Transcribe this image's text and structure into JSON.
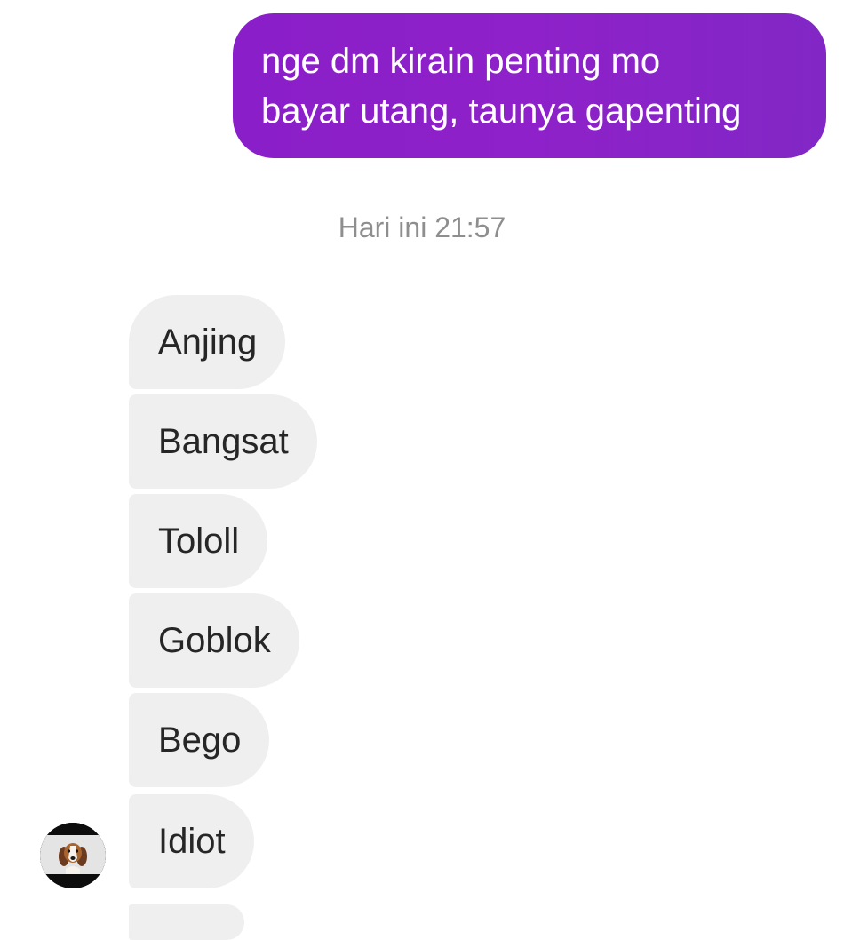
{
  "sent_message": {
    "lines": [
      "nge dm kirain penting mo",
      "bayar utang, taunya gapenting"
    ]
  },
  "timestamp": "Hari ini 21:57",
  "received_messages": [
    "Anjing",
    "Bangsat",
    "Tololl",
    "Goblok",
    "Bego",
    "Idiot"
  ],
  "avatar": {
    "icon": "beagle-dog-avatar"
  },
  "colors": {
    "sent_bubble": "#8a1ec8",
    "received_bubble": "#efefef",
    "timestamp_text": "#8e8e8e",
    "received_text": "#262626"
  }
}
